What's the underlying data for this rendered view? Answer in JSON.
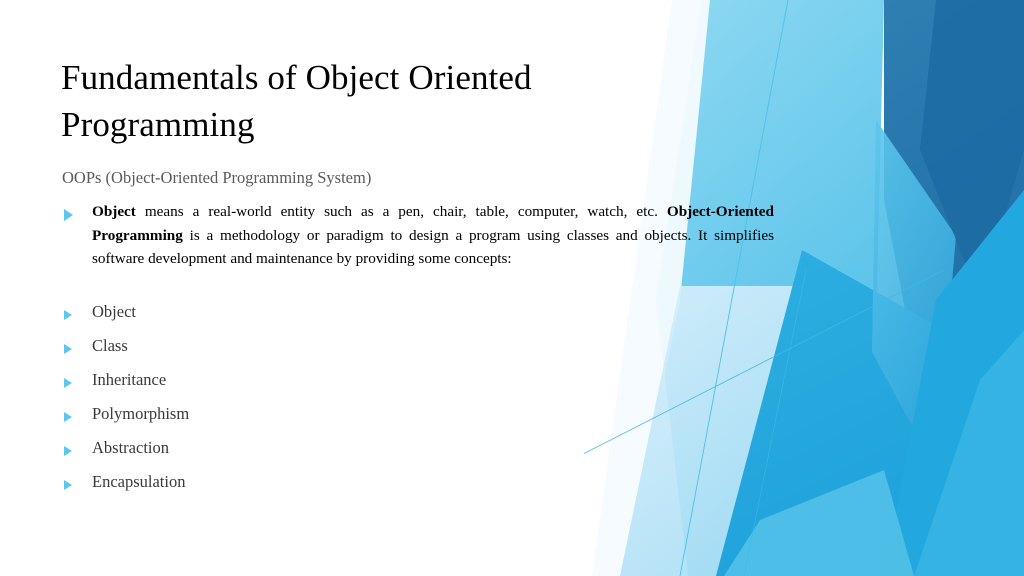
{
  "slide": {
    "background_color": "#ffffff",
    "title": "Fundamentals of Object Oriented Programming",
    "subtitle": "OOPs (Object-Oriented Programming System)",
    "paragraph": {
      "bullet_icon": "triangle-bullet-icon",
      "segments": [
        {
          "text": "Object",
          "bold": true
        },
        {
          "text": " means a real-world entity such as a pen, chair, table, computer, watch, etc. ",
          "bold": false
        },
        {
          "text": "Object-Oriented Programming",
          "bold": true
        },
        {
          "text": " is a methodology or paradigm to design a program using classes and objects. It simplifies software development and maintenance by providing some concepts:",
          "bold": false
        }
      ],
      "plain_text": "Object means a real-world entity such as a pen, chair, table, computer, watch, etc. Object-Oriented Programming is a methodology or paradigm to design a program using classes and objects. It simplifies software development and maintenance by providing some concepts:"
    },
    "concepts": [
      {
        "label": "Object"
      },
      {
        "label": "Class"
      },
      {
        "label": "Inheritance"
      },
      {
        "label": "Polymorphism"
      },
      {
        "label": "Abstraction"
      },
      {
        "label": "Encapsulation"
      }
    ],
    "colors": {
      "bullet_blue": "#5cc7ea",
      "title_black": "#000000",
      "subtitle_gray": "#5a5a5d",
      "body_black": "#000000",
      "deco_pale": "#eaf7fd",
      "deco_light": "#bfe6f7",
      "deco_cyan": "#72cfef",
      "deco_sky": "#2bacdf",
      "deco_mid": "#3a9fd4",
      "deco_steel": "#2b7baf",
      "deco_dark": "#1f6fa8",
      "deco_hairline": "#4cc3e8"
    },
    "decoration": {
      "name": "blue-polygon-graphic"
    }
  }
}
